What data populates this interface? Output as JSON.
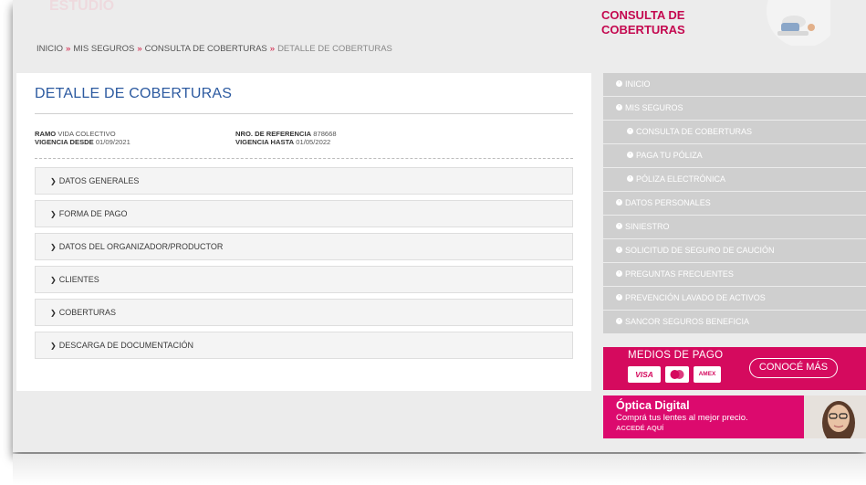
{
  "site": {
    "logo_text": "ESTUDIO",
    "header_title": "CONSULTA DE COBERTURAS"
  },
  "breadcrumb": {
    "items": [
      "INICIO",
      "MIS SEGUROS",
      "CONSULTA DE COBERTURAS",
      "DETALLE DE COBERTURAS"
    ],
    "separator": "»"
  },
  "detail": {
    "title": "DETALLE DE COBERTURAS",
    "ramo_label": "RAMO",
    "ramo_value": "VIDA COLECTIVO",
    "vigencia_desde_label": "VIGENCIA DESDE",
    "vigencia_desde_value": "01/09/2021",
    "referencia_label": "NRO. DE REFERENCIA",
    "referencia_value": "878668",
    "vigencia_hasta_label": "VIGENCIA HASTA",
    "vigencia_hasta_value": "01/05/2022"
  },
  "accordions": [
    {
      "label": "DATOS GENERALES"
    },
    {
      "label": "FORMA DE PAGO"
    },
    {
      "label": "DATOS DEL ORGANIZADOR/PRODUCTOR"
    },
    {
      "label": "CLIENTES"
    },
    {
      "label": "COBERTURAS"
    },
    {
      "label": "DESCARGA DE DOCUMENTACIÓN"
    }
  ],
  "sidebar": {
    "items": [
      {
        "label": "INICIO"
      },
      {
        "label": "MIS SEGUROS"
      },
      {
        "label": "CONSULTA DE COBERTURAS"
      },
      {
        "label": "PAGA TU PÓLIZA"
      },
      {
        "label": "PÓLIZA ELECTRÓNICA"
      },
      {
        "label": "DATOS PERSONALES"
      },
      {
        "label": "SINIESTRO"
      },
      {
        "label": "SOLICITUD DE SEGURO DE CAUCIÓN"
      },
      {
        "label": "PREGUNTAS FRECUENTES"
      },
      {
        "label": "PREVENCIÓN LAVADO DE ACTIVOS"
      },
      {
        "label": "SANCOR SEGUROS BENEFICIA"
      }
    ]
  },
  "banner_pago": {
    "title": "MEDIOS DE PAGO",
    "cards": [
      "VISA",
      "mastercard",
      "AMEX"
    ],
    "button": "CONOCÉ MÁS"
  },
  "banner_optica": {
    "title": "Óptica Digital",
    "subtitle": "Comprá tus lentes al mejor precio.",
    "cta": "ACCEDÉ AQUÍ"
  },
  "colors": {
    "accent": "#d50a5e",
    "title_blue": "#2c5aa0",
    "sidebar_gray": "#cfcfcf"
  }
}
